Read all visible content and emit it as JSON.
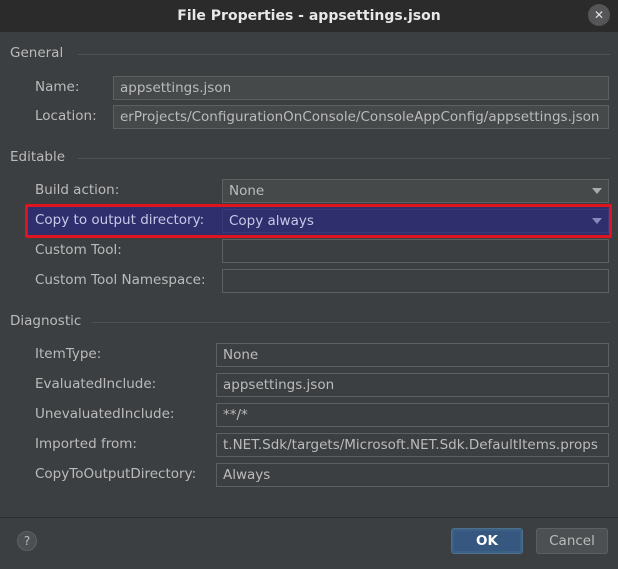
{
  "window": {
    "title": "File Properties - appsettings.json"
  },
  "sections": {
    "general": "General",
    "editable": "Editable",
    "diagnostic": "Diagnostic"
  },
  "general": {
    "name_label": "Name:",
    "name_value": "appsettings.json",
    "location_label": "Location:",
    "location_value": "erProjects/ConfigurationOnConsole/ConsoleAppConfig/appsettings.json"
  },
  "editable": {
    "build_action_label": "Build action:",
    "build_action_value": "None",
    "copy_output_label": "Copy to output directory:",
    "copy_output_value": "Copy always",
    "custom_tool_label": "Custom Tool:",
    "custom_tool_value": "",
    "custom_tool_ns_label": "Custom Tool Namespace:",
    "custom_tool_ns_value": ""
  },
  "diagnostic": {
    "item_type_label": "ItemType:",
    "item_type_value": "None",
    "evaluated_include_label": "EvaluatedInclude:",
    "evaluated_include_value": "appsettings.json",
    "unevaluated_include_label": "UnevaluatedInclude:",
    "unevaluated_include_value": "**/*",
    "imported_from_label": "Imported from:",
    "imported_from_value": "t.NET.Sdk/targets/Microsoft.NET.Sdk.DefaultItems.props",
    "copy_to_output_label": "CopyToOutputDirectory:",
    "copy_to_output_value": "Always"
  },
  "footer": {
    "help_label": "?",
    "ok_label": "OK",
    "cancel_label": "Cancel"
  },
  "colors": {
    "highlight_border": "#e0141e",
    "selection_bg": "#2f2f6e",
    "ok_button": "#365880"
  }
}
